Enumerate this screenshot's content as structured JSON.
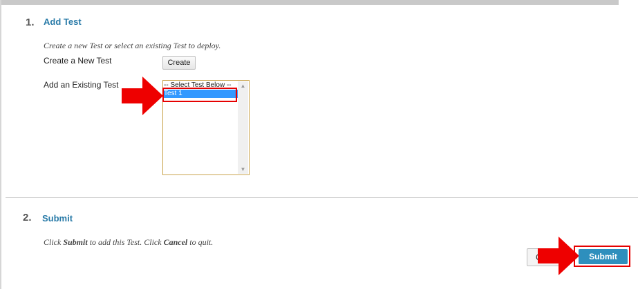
{
  "section1": {
    "number": "1.",
    "title": "Add Test",
    "instructions": "Create a new Test or select an existing Test to deploy.",
    "create_label": "Create a New Test",
    "create_button": "Create",
    "existing_label": "Add an Existing Test",
    "list_options": [
      "-- Select Test Below --",
      "Test 1"
    ],
    "selected_option": "Test 1"
  },
  "section2": {
    "number": "2.",
    "title": "Submit",
    "instr_click1": "Click ",
    "instr_submit": "Submit",
    "instr_mid": " to add this Test. Click ",
    "instr_cancel": "Cancel",
    "instr_end": " to quit.",
    "cancel_button": "C",
    "submit_button": "Submit"
  },
  "colors": {
    "section_title": "#2a7ba8",
    "submit_button": "#2e8fbd",
    "selection": "#3399ff",
    "highlight": "#e60000"
  },
  "icons": [
    "arrow-right-icon",
    "scroll-up-icon",
    "scroll-down-icon"
  ]
}
